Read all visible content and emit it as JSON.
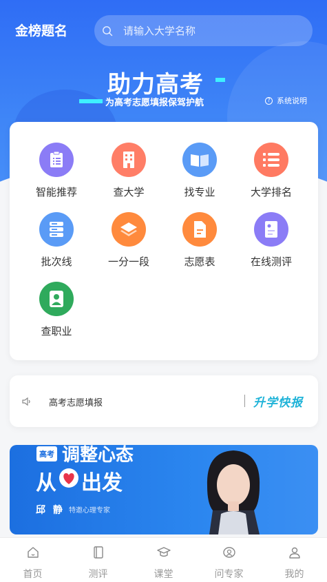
{
  "header": {
    "app_title": "金榜题名",
    "search_placeholder": "请输入大学名称",
    "slogan": "助力高考",
    "sub_slogan": "为高考志愿填报保驾护航",
    "help_label": "系统说明"
  },
  "menu": {
    "items": [
      {
        "label": "智能推荐",
        "icon": "clipboard-list-icon",
        "color": "#8b7cf6"
      },
      {
        "label": "查大学",
        "icon": "building-icon",
        "color": "#ff7e67"
      },
      {
        "label": "找专业",
        "icon": "open-book-icon",
        "color": "#5a9bf6"
      },
      {
        "label": "大学排名",
        "icon": "ranking-list-icon",
        "color": "#ff7a62"
      },
      {
        "label": "批次线",
        "icon": "server-stack-icon",
        "color": "#5a9bf6"
      },
      {
        "label": "一分一段",
        "icon": "layers-icon",
        "color": "#ff8a3d"
      },
      {
        "label": "志愿表",
        "icon": "document-icon",
        "color": "#ff8a3d"
      },
      {
        "label": "在线测评",
        "icon": "test-paper-icon",
        "color": "#8b7cf6"
      },
      {
        "label": "查职业",
        "icon": "person-icon",
        "color": "#2faa5c"
      }
    ]
  },
  "notice": {
    "text": "高考志愿填报",
    "brand": "升学快报"
  },
  "banner": {
    "badge": "高考",
    "line1": "调整心态",
    "line2_a": "从",
    "line2_b": "出发",
    "expert_name": "邱 静",
    "expert_title": "特邀心理专家"
  },
  "tabbar": {
    "items": [
      {
        "label": "首页",
        "icon": "home-icon"
      },
      {
        "label": "测评",
        "icon": "assessment-icon"
      },
      {
        "label": "课堂",
        "icon": "graduation-cap-icon"
      },
      {
        "label": "问专家",
        "icon": "expert-consult-icon"
      },
      {
        "label": "我的",
        "icon": "user-icon"
      }
    ]
  }
}
